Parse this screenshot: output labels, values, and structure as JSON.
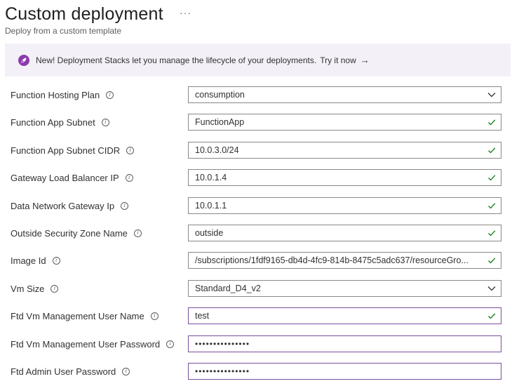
{
  "header": {
    "title": "Custom deployment",
    "subtitle": "Deploy from a custom template",
    "more_label": "···"
  },
  "banner": {
    "text": "New! Deployment Stacks let you manage the lifecycle of your deployments.",
    "link": "Try it now",
    "arrow": "→"
  },
  "fields": [
    {
      "label": "Function Hosting Plan",
      "value": "consumption",
      "type": "select"
    },
    {
      "label": "Function App Subnet",
      "value": "FunctionApp",
      "type": "valid"
    },
    {
      "label": "Function App Subnet CIDR",
      "value": "10.0.3.0/24",
      "type": "valid"
    },
    {
      "label": "Gateway Load Balancer IP",
      "value": "10.0.1.4",
      "type": "valid"
    },
    {
      "label": "Data Network Gateway Ip",
      "value": "10.0.1.1",
      "type": "valid"
    },
    {
      "label": "Outside Security Zone Name",
      "value": "outside",
      "type": "valid"
    },
    {
      "label": "Image Id",
      "value": "/subscriptions/1fdf9165-db4d-4fc9-814b-8475c5adc637/resourceGro...",
      "type": "valid"
    },
    {
      "label": "Vm Size",
      "value": "Standard_D4_v2",
      "type": "select"
    },
    {
      "label": "Ftd Vm Management User Name",
      "value": "test",
      "type": "valid"
    },
    {
      "label": "Ftd Vm Management User Password",
      "value": "•••••••••••••••",
      "type": "password"
    },
    {
      "label": "Ftd Admin User Password",
      "value": "•••••••••••••••",
      "type": "password"
    }
  ],
  "colors": {
    "accent": "#8a3bad",
    "valid_check": "#107c10",
    "banner_bg": "#f4f0f8"
  },
  "icons": {
    "info": "info-icon",
    "check": "checkmark-icon",
    "chevron": "chevron-down-icon",
    "rocket": "rocket-icon"
  }
}
